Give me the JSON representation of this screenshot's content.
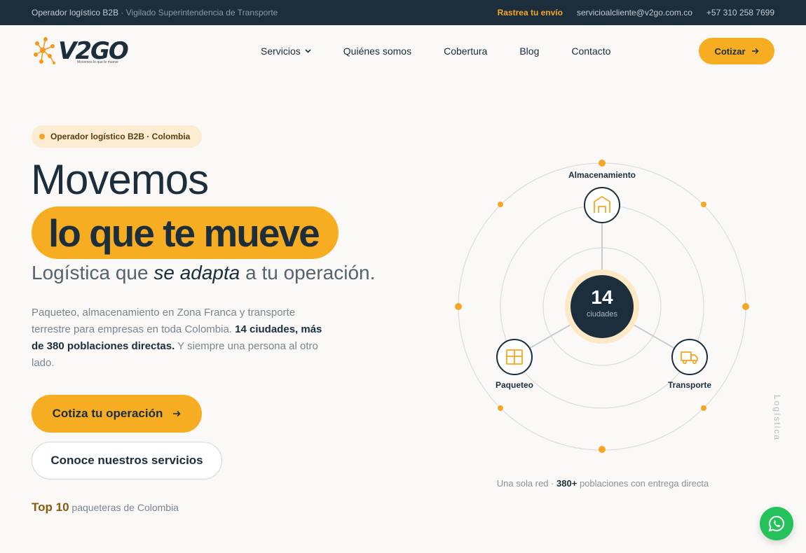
{
  "topbar": {
    "tagline_main": "Operador logístico B2B",
    "tagline_sep": " · ",
    "tagline_extra": "Vigilado Superintendencia de Transporte",
    "track_label": "Rastrea tu envío",
    "email": "servicioalcliente@v2go.com.co",
    "phone": "+57 310 258 7699"
  },
  "nav": {
    "logo_word": "V2GO",
    "logo_tagline": "Movemos lo que te mueve",
    "menu": [
      "Servicios",
      "Quiénes somos",
      "Cobertura",
      "Blog",
      "Contacto"
    ],
    "cta_label": "Cotizar"
  },
  "hero": {
    "badge": "Operador logístico B2B · Colombia",
    "title_line1": "Movemos",
    "title_highlight": "lo que te mueve",
    "subtitle_pre": "Logística que ",
    "subtitle_em": "se adapta",
    "subtitle_post": " a tu operación.",
    "desc_pre": "Paqueteo, almacenamiento en Zona Franca y transporte terrestre para empresas en toda Colombia. ",
    "desc_bold": "14 ciudades, más de 380 poblaciones directas.",
    "desc_post": " Y siempre una persona al otro lado.",
    "primary_cta": "Cotiza tu operación",
    "secondary_cta": "Conoce nuestros servicios",
    "top_bold": "Top 10",
    "top_rest": " paqueteras de Colombia"
  },
  "diagram": {
    "center_number": "14",
    "center_label": "ciudades",
    "nodes": [
      "Almacenamiento",
      "Paqueteo",
      "Transporte"
    ],
    "caption_pre": "Una sola red · ",
    "caption_bold": "380+",
    "caption_post": " poblaciones con entrega directa",
    "side_label": "Logística"
  },
  "colors": {
    "accent": "#f7ad22",
    "navy": "#1c2e3c",
    "whatsapp": "#25c15a"
  },
  "icons": [
    "arrow-right-icon",
    "chevron-down-icon",
    "warehouse-icon",
    "box-icon",
    "truck-icon",
    "whatsapp-icon"
  ]
}
